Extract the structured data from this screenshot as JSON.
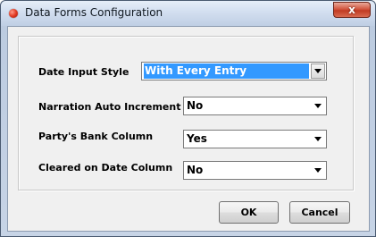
{
  "window": {
    "title": "Data Forms Configuration",
    "close_symbol": "x",
    "icon": "app-icon-red-dot"
  },
  "fields": [
    {
      "label": "Date Input Style",
      "value": "With Every Entry",
      "selected": true
    },
    {
      "label": "Narration Auto Increment",
      "value": "No",
      "selected": false
    },
    {
      "label": "Party's Bank Column",
      "value": "Yes",
      "selected": false
    },
    {
      "label": "Cleared on Date Column",
      "value": "No",
      "selected": false
    }
  ],
  "buttons": {
    "ok_label": "OK",
    "cancel_label": "Cancel"
  },
  "colors": {
    "selection_highlight": "#3399ff",
    "close_button": "#c13b22"
  }
}
